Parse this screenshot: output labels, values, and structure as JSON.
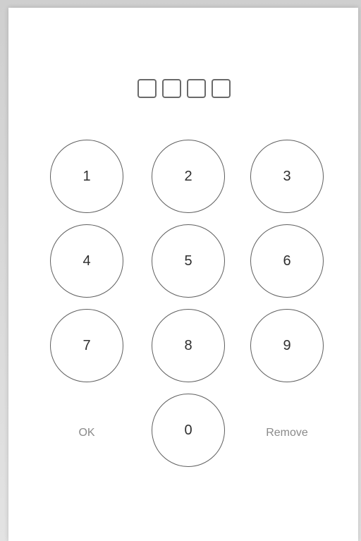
{
  "pin": {
    "slots": [
      "",
      "",
      "",
      ""
    ]
  },
  "keypad": {
    "keys": [
      "1",
      "2",
      "3",
      "4",
      "5",
      "6",
      "7",
      "8",
      "9",
      "0"
    ],
    "ok_label": "OK",
    "remove_label": "Remove"
  }
}
